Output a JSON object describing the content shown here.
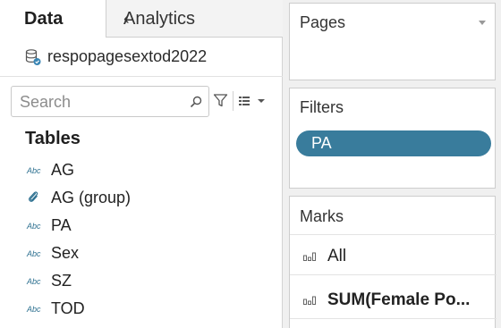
{
  "tabs": {
    "data": "Data",
    "analytics": "Analytics"
  },
  "datasource": {
    "name": "respopagesextod2022"
  },
  "search": {
    "placeholder": "Search",
    "value": ""
  },
  "tables": {
    "heading": "Tables",
    "fields": [
      {
        "type": "Abc",
        "label": "AG"
      },
      {
        "type": "group",
        "label": "AG (group)"
      },
      {
        "type": "Abc",
        "label": "PA"
      },
      {
        "type": "Abc",
        "label": "Sex"
      },
      {
        "type": "Abc",
        "label": "SZ"
      },
      {
        "type": "Abc",
        "label": "TOD"
      }
    ]
  },
  "pages": {
    "title": "Pages"
  },
  "filters": {
    "title": "Filters",
    "pills": [
      {
        "label": "PA"
      }
    ]
  },
  "marks": {
    "title": "Marks",
    "rows": [
      {
        "label": "All"
      },
      {
        "label": "SUM(Female Po..."
      }
    ]
  },
  "colors": {
    "pill": "#397c9c",
    "type_text": "#2d7090",
    "shelf_bg": "#f0f0f0"
  }
}
